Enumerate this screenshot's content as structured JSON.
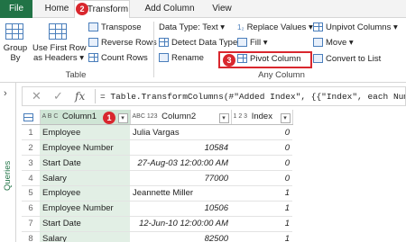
{
  "tabs": [
    "File",
    "Home",
    "Transform",
    "Add Column",
    "View"
  ],
  "badges": [
    "2",
    "1",
    "3"
  ],
  "ribbon": {
    "group_by": "Group\nBy",
    "group_by_l1": "Group",
    "group_by_l2": "By",
    "first_row_l1": "Use First Row",
    "first_row_l2": "as Headers",
    "transpose": "Transpose",
    "reverse_rows": "Reverse Rows",
    "count_rows": "Count Rows",
    "table_group": "Table",
    "data_type": "Data Type: Text",
    "detect_type": "Detect Data Type",
    "rename": "Rename",
    "replace_values": "Replace Values",
    "fill": "Fill",
    "pivot_column": "Pivot Column",
    "unpivot_columns": "Unpivot Columns",
    "move": "Move",
    "convert_to_list": "Convert to List",
    "any_column_group": "Any Column"
  },
  "side_pane": {
    "label": "Queries"
  },
  "formula_bar": {
    "text": "= Table.TransformColumns(#\"Added Index\", {{\"Index\", each Number."
  },
  "grid": {
    "columns": [
      {
        "type": "A B C",
        "name": "Column1"
      },
      {
        "type": "ABC 123",
        "name": "Column2"
      },
      {
        "type": "1 2 3",
        "name": "Index"
      }
    ],
    "rows": [
      {
        "num": "1",
        "c1": "Employee",
        "c2": "Julia Vargas",
        "idx": "0"
      },
      {
        "num": "2",
        "c1": "Employee Number",
        "c2": "10584",
        "idx": "0"
      },
      {
        "num": "3",
        "c1": "Start Date",
        "c2": "27-Aug-03 12:00:00 AM",
        "idx": "0"
      },
      {
        "num": "4",
        "c1": "Salary",
        "c2": "77000",
        "idx": "0"
      },
      {
        "num": "5",
        "c1": "Employee",
        "c2": "Jeannette Miller",
        "idx": "1"
      },
      {
        "num": "6",
        "c1": "Employee Number",
        "c2": "10506",
        "idx": "1"
      },
      {
        "num": "7",
        "c1": "Start Date",
        "c2": "12-Jun-10 12:00:00 AM",
        "idx": "1"
      },
      {
        "num": "8",
        "c1": "Salary",
        "c2": "82500",
        "idx": "1"
      }
    ]
  }
}
